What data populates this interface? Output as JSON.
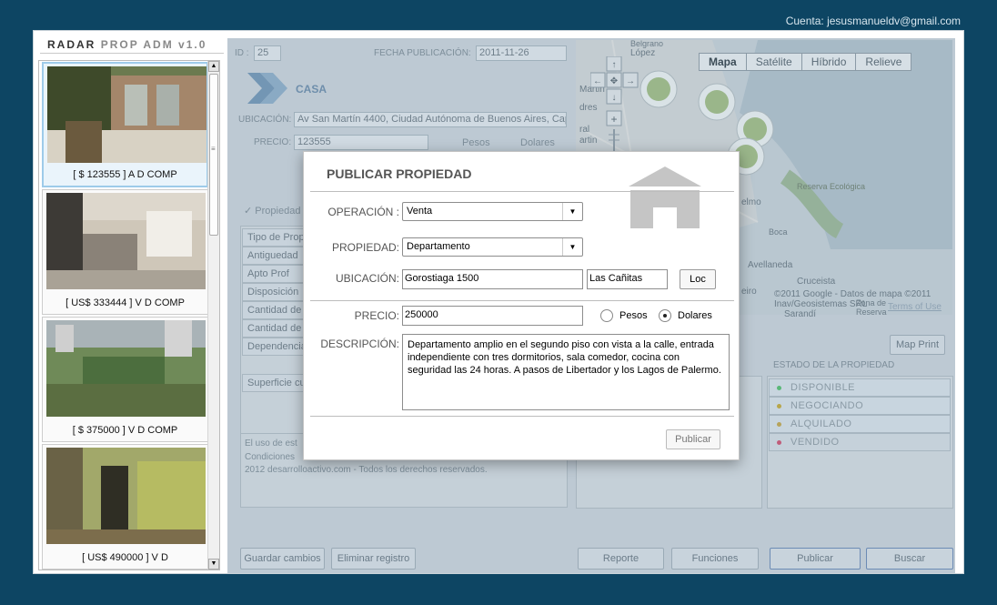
{
  "app": {
    "title": "RADAR",
    "title_sub": "PROP ADM v1.0",
    "account": "Cuenta: jesusmanueldv@gmail.com"
  },
  "sidebar": {
    "items": [
      {
        "label": "[ $ 123555 ] A D COMP",
        "selected": true
      },
      {
        "label": "[ US$ 333444 ] V D COMP",
        "selected": false
      },
      {
        "label": "[ $ 375000 ] V D COMP",
        "selected": false
      },
      {
        "label": "[ US$ 490000 ] V D",
        "selected": false
      }
    ]
  },
  "background_form": {
    "id_label": "ID :",
    "id_value": "25",
    "fecha_label": "FECHA PUBLICACIÓN:",
    "fecha_value": "2011-11-26",
    "type": "CASA",
    "ubicacion_label": "UBICACIÓN:",
    "ubicacion_value": "Av San Martín 4400, Ciudad Autónoma de Buenos Aires, Cap",
    "precio_label": "PRECIO:",
    "precio_value": "123555",
    "pesos": "Pesos",
    "dolares": "Dolares",
    "propiedad_check": "Propiedad",
    "rows": [
      "Tipo de Prop",
      "Antiguedad",
      "Apto Prof",
      "Disposición",
      "Cantidad de",
      "Cantidad de",
      "Dependencia"
    ],
    "superficie": "Superficie cu",
    "legal": [
      "El uso de est",
      "Condiciones",
      "2012 desarrolloactivo.com - Todos los derechos reservados."
    ],
    "map_buttons": [
      "Mapa",
      "Satélite",
      "Híbrido",
      "Relieve"
    ],
    "map_labels": [
      "López",
      "Martin",
      "dres",
      "ral",
      "artin",
      "Reserva Ecológica",
      "Boca",
      "Avellaneda",
      "Cruceista",
      "Sarandí",
      "Reserva",
      "Zona de",
      "eiro",
      "elmo",
      "Belgrano"
    ],
    "map_copyright": "©2011 Google - Datos de mapa ©2011 Inav/Geosistemas SRL",
    "terms": "Terms of Use",
    "map_print": "Map Print",
    "estado_header": "ESTADO DE LA PROPIEDAD",
    "estados": [
      {
        "label": "DISPONIBLE",
        "color": "#5ab878"
      },
      {
        "label": "NEGOCIANDO",
        "color": "#b7a64a"
      },
      {
        "label": "ALQUILADO",
        "color": "#b6a35b"
      },
      {
        "label": "VENDIDO",
        "color": "#c05d7a"
      }
    ],
    "buttons": {
      "guardar": "Guardar cambios",
      "eliminar": "Eliminar registro",
      "reporte": "Reporte",
      "funciones": "Funciones",
      "publicar": "Publicar",
      "buscar": "Buscar"
    }
  },
  "modal": {
    "title": "PUBLICAR PROPIEDAD",
    "operacion_label": "OPERACIÓN :",
    "operacion_value": "Venta",
    "propiedad_label": "PROPIEDAD:",
    "propiedad_value": "Departamento",
    "ubicacion_label": "UBICACIÓN:",
    "ubicacion_value": "Gorostiaga 1500",
    "barrio_value": "Las Cañitas",
    "loc_button": "Loc",
    "precio_label": "PRECIO:",
    "precio_value": "250000",
    "pesos_label": "Pesos",
    "dolares_label": "Dolares",
    "currency_selected": "Dolares",
    "descripcion_label": "DESCRIPCIÓN:",
    "descripcion_value": "Departamento amplio en el segundo piso con vista a la calle, entrada independiente con tres dormitorios, sala comedor, cocina con seguridad las 24 horas. A pasos de Libertador y los Lagos de Palermo.",
    "publicar_button": "Publicar"
  }
}
